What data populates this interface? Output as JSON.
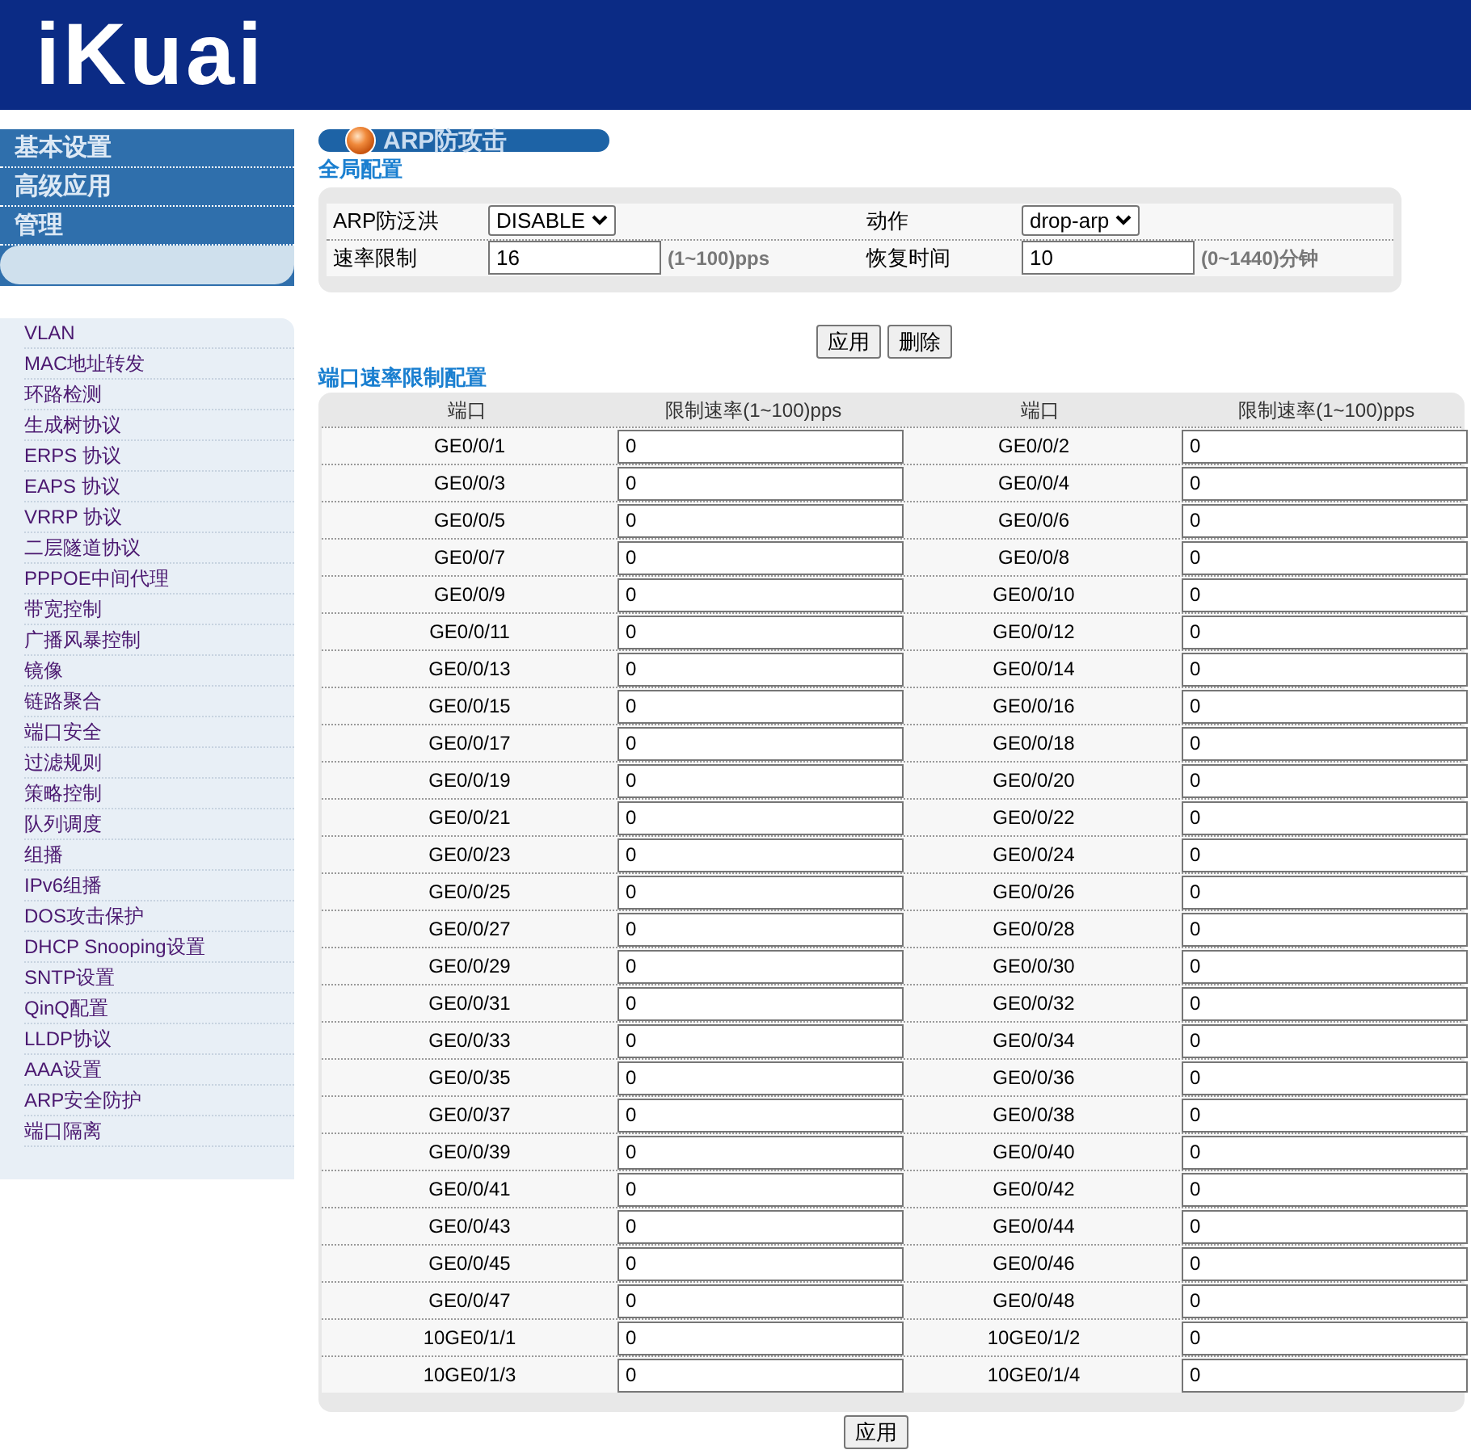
{
  "logo": "iKuai",
  "top_menu": [
    "基本设置",
    "高级应用",
    "管理"
  ],
  "sidebar": {
    "items": [
      "VLAN",
      "MAC地址转发",
      "环路检测",
      "生成树协议",
      "ERPS 协议",
      "EAPS 协议",
      "VRRP 协议",
      "二层隧道协议",
      "PPPOE中间代理",
      "带宽控制",
      "广播风暴控制",
      "镜像",
      "链路聚合",
      "端口安全",
      "过滤规则",
      "策略控制",
      "队列调度",
      "组播",
      "IPv6组播",
      "DOS攻击保护",
      "DHCP Snooping设置",
      "SNTP设置",
      "QinQ配置",
      "LLDP协议",
      "AAA设置",
      "ARP安全防护",
      "端口隔离"
    ]
  },
  "page_title": "ARP防攻击",
  "global": {
    "title": "全局配置",
    "fields": [
      {
        "label": "ARP防泛洪",
        "kind": "select",
        "value": "DISABLE"
      },
      {
        "label": "动作",
        "kind": "select",
        "value": "drop-arp"
      },
      {
        "label": "速率限制",
        "kind": "input",
        "value": "16",
        "hint": "(1~100)pps"
      },
      {
        "label": "恢复时间",
        "kind": "input",
        "value": "10",
        "hint": "(0~1440)分钟"
      }
    ],
    "buttons": [
      "应用",
      "删除"
    ]
  },
  "port_table": {
    "title": "端口速率限制配置",
    "columns": [
      "端口",
      "限制速率(1~100)pps",
      "端口",
      "限制速率(1~100)pps"
    ],
    "rows": [
      [
        "GE0/0/1",
        "0",
        "GE0/0/2",
        "0"
      ],
      [
        "GE0/0/3",
        "0",
        "GE0/0/4",
        "0"
      ],
      [
        "GE0/0/5",
        "0",
        "GE0/0/6",
        "0"
      ],
      [
        "GE0/0/7",
        "0",
        "GE0/0/8",
        "0"
      ],
      [
        "GE0/0/9",
        "0",
        "GE0/0/10",
        "0"
      ],
      [
        "GE0/0/11",
        "0",
        "GE0/0/12",
        "0"
      ],
      [
        "GE0/0/13",
        "0",
        "GE0/0/14",
        "0"
      ],
      [
        "GE0/0/15",
        "0",
        "GE0/0/16",
        "0"
      ],
      [
        "GE0/0/17",
        "0",
        "GE0/0/18",
        "0"
      ],
      [
        "GE0/0/19",
        "0",
        "GE0/0/20",
        "0"
      ],
      [
        "GE0/0/21",
        "0",
        "GE0/0/22",
        "0"
      ],
      [
        "GE0/0/23",
        "0",
        "GE0/0/24",
        "0"
      ],
      [
        "GE0/0/25",
        "0",
        "GE0/0/26",
        "0"
      ],
      [
        "GE0/0/27",
        "0",
        "GE0/0/28",
        "0"
      ],
      [
        "GE0/0/29",
        "0",
        "GE0/0/30",
        "0"
      ],
      [
        "GE0/0/31",
        "0",
        "GE0/0/32",
        "0"
      ],
      [
        "GE0/0/33",
        "0",
        "GE0/0/34",
        "0"
      ],
      [
        "GE0/0/35",
        "0",
        "GE0/0/36",
        "0"
      ],
      [
        "GE0/0/37",
        "0",
        "GE0/0/38",
        "0"
      ],
      [
        "GE0/0/39",
        "0",
        "GE0/0/40",
        "0"
      ],
      [
        "GE0/0/41",
        "0",
        "GE0/0/42",
        "0"
      ],
      [
        "GE0/0/43",
        "0",
        "GE0/0/44",
        "0"
      ],
      [
        "GE0/0/45",
        "0",
        "GE0/0/46",
        "0"
      ],
      [
        "GE0/0/47",
        "0",
        "GE0/0/48",
        "0"
      ],
      [
        "10GE0/1/1",
        "0",
        "10GE0/1/2",
        "0"
      ],
      [
        "10GE0/1/3",
        "0",
        "10GE0/1/4",
        "0"
      ]
    ],
    "button": "应用"
  }
}
